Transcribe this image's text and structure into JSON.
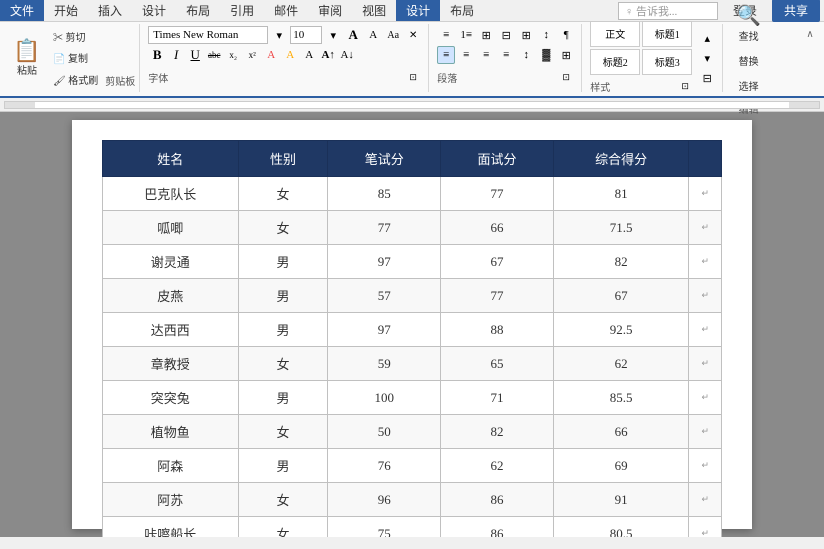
{
  "menus": {
    "items": [
      "文件",
      "开始",
      "插入",
      "设计",
      "布局",
      "引用",
      "邮件",
      "审阅",
      "视图",
      "设计",
      "布局"
    ],
    "active": "设计"
  },
  "toolbar": {
    "font_name": "Times New Roman",
    "font_size": "10",
    "tell_me": "♀ 告诉我...",
    "login": "登录",
    "share": "共享",
    "paste_label": "粘贴",
    "clipboard_label": "剪贴板",
    "font_label": "字体",
    "para_label": "段落",
    "style_label": "样式",
    "edit_label": "编辑",
    "style_name": "样式",
    "collapse": "∧"
  },
  "table": {
    "headers": [
      "姓名",
      "性别",
      "笔试分",
      "面试分",
      "综合得分"
    ],
    "rows": [
      [
        "巴克队长",
        "女",
        "85",
        "77",
        "81"
      ],
      [
        "呱唧",
        "女",
        "77",
        "66",
        "71.5"
      ],
      [
        "谢灵通",
        "男",
        "97",
        "67",
        "82"
      ],
      [
        "皮燕",
        "男",
        "57",
        "77",
        "67"
      ],
      [
        "达西西",
        "男",
        "97",
        "88",
        "92.5"
      ],
      [
        "章教授",
        "女",
        "59",
        "65",
        "62"
      ],
      [
        "突突兔",
        "男",
        "100",
        "71",
        "85.5"
      ],
      [
        "植物鱼",
        "女",
        "50",
        "82",
        "66"
      ],
      [
        "阿森",
        "男",
        "76",
        "62",
        "69"
      ],
      [
        "阿苏",
        "女",
        "96",
        "86",
        "91"
      ],
      [
        "咔嚓船长",
        "女",
        "75",
        "86",
        "80.5"
      ]
    ]
  },
  "icons": {
    "paste": "📋",
    "cut": "✂",
    "copy": "📄",
    "format": "🖌",
    "bold": "B",
    "italic": "I",
    "underline": "U",
    "strikethrough": "abc",
    "superscript": "x²",
    "subscript": "x₂",
    "font_color": "A",
    "highlight": "A",
    "case": "Aa",
    "enlarge": "A↑",
    "shrink": "A↓",
    "clear": "✕",
    "bullets": "≡",
    "numbering": "1≡",
    "multilevel": "⊞",
    "indent_dec": "←⊟",
    "indent_inc": "→⊞",
    "sort": "↕A",
    "para_mark": "¶",
    "align_left": "≡←",
    "align_center": "≡",
    "align_right": "≡→",
    "justify": "≡≡",
    "line_spacing": "↕",
    "shading": "▓",
    "border": "⊞",
    "style_icon": "🎨",
    "find": "🔍",
    "expand_down": "▾",
    "expand_right": "▸",
    "collapse_ribbon": "▲"
  }
}
